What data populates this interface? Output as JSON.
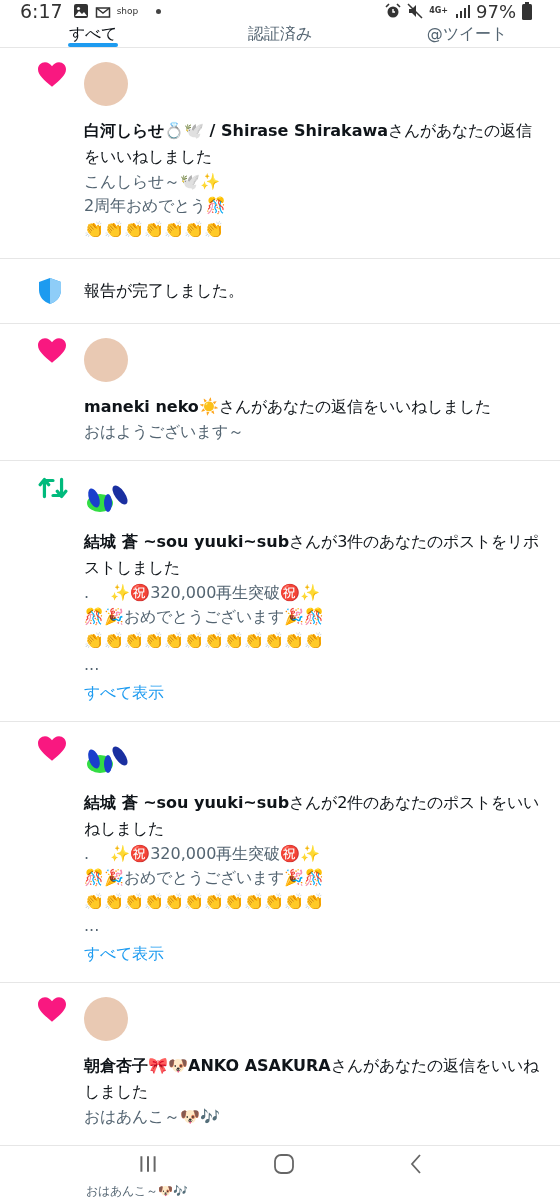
{
  "status_bar": {
    "time": "6:17",
    "notification_label": "shop",
    "network": "4G+",
    "battery": "97%"
  },
  "tabs": [
    {
      "label": "すべて",
      "selected": true
    },
    {
      "label": "認証済み",
      "selected": false
    },
    {
      "label": "@ツイート",
      "selected": false
    }
  ],
  "notifications": [
    {
      "kind": "like",
      "avatar": {
        "kind": "photo"
      },
      "message": "**白河しらせ💍🕊️ / Shirase Shirakawa**さんがあなたの返信をいいねしました",
      "lines": [
        "こんしらせ～🕊️✨",
        "2周年おめでとう🎊",
        "👏👏👏👏👏👏👏"
      ]
    },
    {
      "kind": "system",
      "message": "報告が完了しました。"
    },
    {
      "kind": "like",
      "avatar": {
        "kind": "photo"
      },
      "message": "**maneki neko☀️**さんがあなたの返信をいいねしました",
      "lines": [
        "おはようございます～"
      ]
    },
    {
      "kind": "repost",
      "avatar": {
        "kind": "drawing"
      },
      "message": "**結城 蒼 ~sou yuuki~sub**さんが3件のあなたのポストをリポストしました",
      "lines": [
        ".　 ✨㊗️320,000再生突破㊗️✨",
        "🎊🎉おめでとうございます🎉🎊",
        "👏👏👏👏👏👏👏👏👏👏👏👏",
        "..."
      ],
      "more_link": "すべて表示"
    },
    {
      "kind": "like",
      "avatar": {
        "kind": "drawing"
      },
      "message": "**結城 蒼 ~sou yuuki~sub**さんが2件のあなたのポストをいいねしました",
      "lines": [
        ".　 ✨㊗️320,000再生突破㊗️✨",
        "🎊🎉おめでとうございます🎉🎊",
        "👏👏👏👏👏👏👏👏👏👏👏👏",
        "..."
      ],
      "more_link": "すべて表示"
    },
    {
      "kind": "like",
      "avatar": {
        "kind": "photo"
      },
      "message": "**朝倉杏子🎀🐶ANKO ASAKURA**さんがあなたの返信をいいねしました",
      "lines": [
        "おはあんこ～🐶🎶"
      ]
    }
  ],
  "behind_nav_text": "おはあんこ～🐶🎶"
}
